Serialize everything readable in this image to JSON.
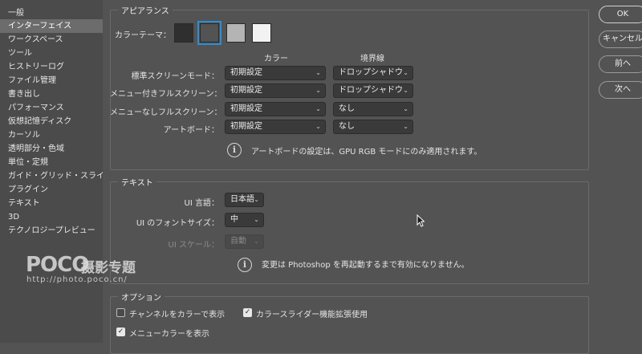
{
  "sidebar": {
    "items": [
      {
        "label": "一般",
        "active": false
      },
      {
        "label": "インターフェイス",
        "active": true
      },
      {
        "label": "ワークスペース",
        "active": false
      },
      {
        "label": "ツール",
        "active": false
      },
      {
        "label": "ヒストリーログ",
        "active": false
      },
      {
        "label": "ファイル管理",
        "active": false
      },
      {
        "label": "書き出し",
        "active": false
      },
      {
        "label": "パフォーマンス",
        "active": false
      },
      {
        "label": "仮想記憶ディスク",
        "active": false
      },
      {
        "label": "カーソル",
        "active": false
      },
      {
        "label": "透明部分・色域",
        "active": false
      },
      {
        "label": "単位・定規",
        "active": false
      },
      {
        "label": "ガイド・グリッド・スライス",
        "active": false
      },
      {
        "label": "プラグイン",
        "active": false
      },
      {
        "label": "テキスト",
        "active": false
      },
      {
        "label": "3D",
        "active": false
      },
      {
        "label": "テクノロジープレビュー",
        "active": false
      }
    ]
  },
  "appearance": {
    "title": "アピアランス",
    "color_theme_label": "カラーテーマ：",
    "swatch_colors": [
      "#2f2f2f",
      "#535353",
      "#b4b4b4",
      "#f2f2f2"
    ],
    "selected_swatch": 1,
    "col_color": "カラー",
    "col_border": "境界線",
    "rows": [
      {
        "label": "標準スクリーンモード：",
        "color": "初期設定",
        "border": "ドロップシャドウ"
      },
      {
        "label": "メニュー付きフルスクリーン：",
        "color": "初期設定",
        "border": "ドロップシャドウ"
      },
      {
        "label": "メニューなしフルスクリーン：",
        "color": "初期設定",
        "border": "なし"
      },
      {
        "label": "アートボード：",
        "color": "初期設定",
        "border": "なし"
      }
    ],
    "info_text": "アートボードの設定は、GPU RGB モードにのみ適用されます。"
  },
  "text": {
    "title": "テキスト",
    "ui_language_label": "UI 言語：",
    "ui_language_value": "日本語",
    "ui_font_size_label": "UI のフォントサイズ：",
    "ui_font_size_value": "中",
    "ui_scale_label": "UI スケール：",
    "ui_scale_value": "自動",
    "info_text": "変更は Photoshop を再起動するまで有効になりません。"
  },
  "options": {
    "title": "オプション",
    "channel_color_label": "チャンネルをカラーで表示",
    "channel_color_checked": false,
    "color_slider_label": "カラースライダー機能拡張使用",
    "color_slider_checked": true,
    "menu_color_label": "メニューカラーを表示",
    "menu_color_checked": true
  },
  "buttons": {
    "ok": "OK",
    "cancel": "キャンセル",
    "prev": "前へ",
    "next": "次へ"
  },
  "watermark": {
    "brand": "POCO",
    "title": "摄影专题",
    "url": "http://photo.poco.cn/"
  },
  "icons": {
    "chevron": "⌄",
    "info": "i",
    "check": "✓"
  },
  "accent_color": "#2b8ed8"
}
